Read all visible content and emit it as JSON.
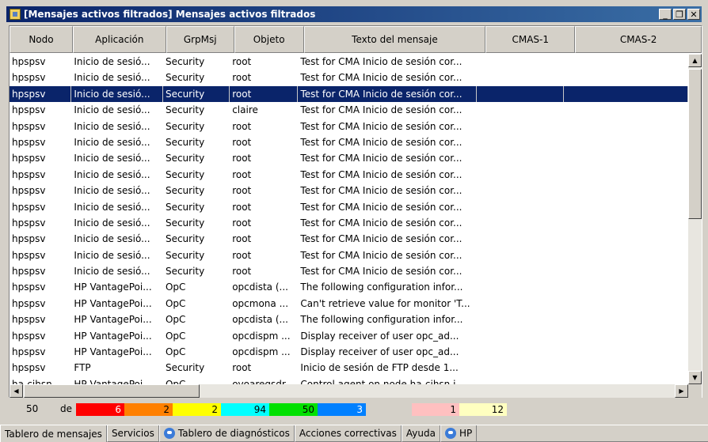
{
  "window": {
    "title": "[Mensajes activos filtrados] Mensajes activos filtrados",
    "controls": {
      "minimize": "_",
      "restore": "❐",
      "close": "✕"
    }
  },
  "table": {
    "columns": [
      "Nodo",
      "Aplicación",
      "GrpMsj",
      "Objeto",
      "Texto del mensaje",
      "CMAS-1",
      "CMAS-2"
    ],
    "selected_row": 2,
    "rows": [
      [
        "hpspsv",
        "Inicio de sesió...",
        "Security",
        "root",
        "Test for CMA Inicio de sesión cor...",
        "",
        ""
      ],
      [
        "hpspsv",
        "Inicio de sesió...",
        "Security",
        "root",
        "Test for CMA Inicio de sesión cor...",
        "",
        ""
      ],
      [
        "hpspsv",
        "Inicio de sesió...",
        "Security",
        "root",
        "Test for CMA Inicio de sesión cor...",
        "",
        ""
      ],
      [
        "hpspsv",
        "Inicio de sesió...",
        "Security",
        "claire",
        "Test for CMA Inicio de sesión cor...",
        "",
        ""
      ],
      [
        "hpspsv",
        "Inicio de sesió...",
        "Security",
        "root",
        "Test for CMA Inicio de sesión cor...",
        "",
        ""
      ],
      [
        "hpspsv",
        "Inicio de sesió...",
        "Security",
        "root",
        "Test for CMA Inicio de sesión cor...",
        "",
        ""
      ],
      [
        "hpspsv",
        "Inicio de sesió...",
        "Security",
        "root",
        "Test for CMA Inicio de sesión cor...",
        "",
        ""
      ],
      [
        "hpspsv",
        "Inicio de sesió...",
        "Security",
        "root",
        "Test for CMA Inicio de sesión cor...",
        "",
        ""
      ],
      [
        "hpspsv",
        "Inicio de sesió...",
        "Security",
        "root",
        "Test for CMA Inicio de sesión cor...",
        "",
        ""
      ],
      [
        "hpspsv",
        "Inicio de sesió...",
        "Security",
        "root",
        "Test for CMA Inicio de sesión cor...",
        "",
        ""
      ],
      [
        "hpspsv",
        "Inicio de sesió...",
        "Security",
        "root",
        "Test for CMA Inicio de sesión cor...",
        "",
        ""
      ],
      [
        "hpspsv",
        "Inicio de sesió...",
        "Security",
        "root",
        "Test for CMA Inicio de sesión cor...",
        "",
        ""
      ],
      [
        "hpspsv",
        "Inicio de sesió...",
        "Security",
        "root",
        "Test for CMA Inicio de sesión cor...",
        "",
        ""
      ],
      [
        "hpspsv",
        "Inicio de sesió...",
        "Security",
        "root",
        "Test for CMA Inicio de sesión cor...",
        "",
        ""
      ],
      [
        "hpspsv",
        "HP VantagePoi...",
        "OpC",
        "opcdista (...",
        "The following configuration infor...",
        "",
        ""
      ],
      [
        "hpspsv",
        "HP VantagePoi...",
        "OpC",
        "opcmona ...",
        "Can't retrieve value for monitor 'T...",
        "",
        ""
      ],
      [
        "hpspsv",
        "HP VantagePoi...",
        "OpC",
        "opcdista (...",
        "The following configuration infor...",
        "",
        ""
      ],
      [
        "hpspsv",
        "HP VantagePoi...",
        "OpC",
        "opcdispm ...",
        "Display receiver of user opc_ad...",
        "",
        ""
      ],
      [
        "hpspsv",
        "HP VantagePoi...",
        "OpC",
        "opcdispm ...",
        "Display receiver of user opc_ad...",
        "",
        ""
      ],
      [
        "hpspsv",
        "FTP",
        "Security",
        "root",
        "Inicio de sesión de FTP desde 1...",
        "",
        ""
      ],
      [
        "ha-cihsn",
        "HP VantagePoi...",
        "OpC",
        "ovoaregsdr...",
        "Control agent on node ha-cihsn i...",
        "",
        ""
      ]
    ]
  },
  "status": {
    "total": "50",
    "of_label": "de",
    "severity_counts": [
      {
        "value": "6",
        "color": "#ff0000"
      },
      {
        "value": "2",
        "color": "#ff8000"
      },
      {
        "value": "2",
        "color": "#ffff00"
      },
      {
        "value": "94",
        "color": "#00ffff"
      },
      {
        "value": "50",
        "color": "#00e000"
      },
      {
        "value": "3",
        "color": "#0080ff"
      }
    ],
    "extra_counts": [
      {
        "value": "1",
        "color": "#ffc0c0"
      },
      {
        "value": "12",
        "color": "#ffffc0"
      }
    ]
  },
  "tabs": [
    {
      "label": "Tablero de mensajes",
      "icon": "",
      "active": true
    },
    {
      "label": "Servicios",
      "icon": "",
      "active": false
    },
    {
      "label": "Tablero de diagnósticos",
      "icon": "ie-icon",
      "active": false
    },
    {
      "label": "Acciones correctivas",
      "icon": "",
      "active": false
    },
    {
      "label": "Ayuda",
      "icon": "",
      "active": false
    },
    {
      "label": "HP",
      "icon": "ie-icon",
      "active": false
    }
  ]
}
